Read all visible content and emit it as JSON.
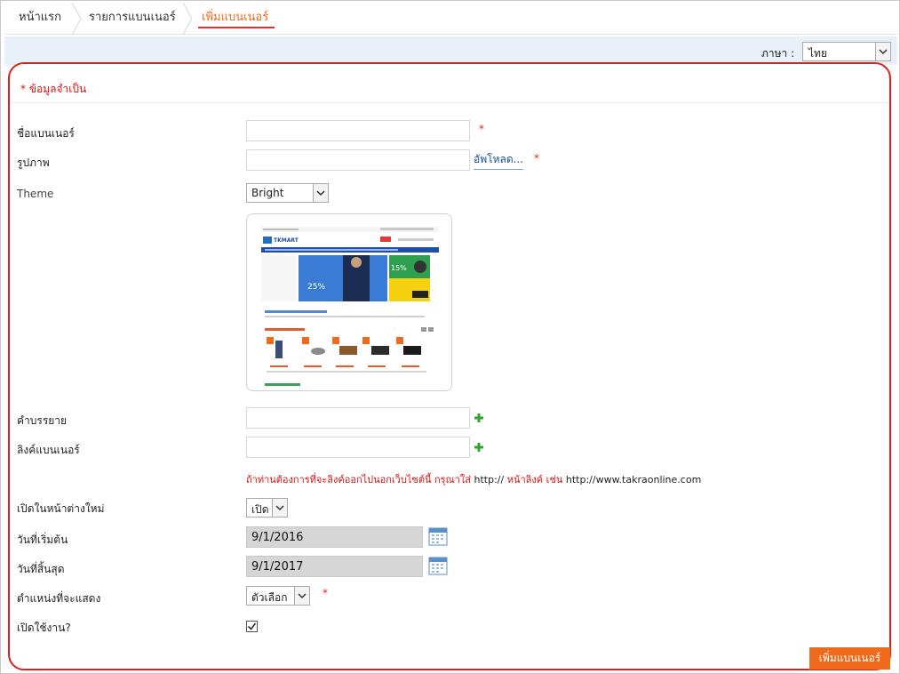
{
  "breadcrumb": {
    "home": "หน้าแรก",
    "list": "รายการแบนเนอร์",
    "current": "เพิ่มแบนเนอร์"
  },
  "language": {
    "label": "ภาษา :",
    "value": "ไทย"
  },
  "form": {
    "required_note": "* ข้อมูลจำเป็น",
    "banner_name_label": "ชื่อแบนเนอร์",
    "image_label": "รูปภาพ",
    "upload_label": "อัพโหลด...",
    "theme_label": "Theme",
    "theme_value": "Bright",
    "description_label": "คำบรรยาย",
    "link_label": "ลิงค์แบนเนอร์",
    "hint_a": "ถ้าท่านต้องการที่จะลิงค์ออกไปนอกเว็บไซต์นี้ กรุณาใส่ ",
    "hint_b": "http://",
    "hint_c": " หน้าลิงค์ เช่น ",
    "hint_d": "http://www.takraonline.com",
    "new_window_label": "เปิดในหน้าต่างใหม่",
    "new_window_value": "เปิด",
    "start_date_label": "วันที่เริ่มต้น",
    "start_date_value": "9/1/2016",
    "end_date_label": "วันที่สิ้นสุด",
    "end_date_value": "9/1/2017",
    "position_label": "ตำแหน่งที่จะแสดง",
    "position_value": "ตัวเลือก",
    "active_label": "เปิดใช้งาน?",
    "active_checked": true,
    "required_star": "*",
    "submit_label": "เพิ่มแบนเนอร์"
  },
  "preview": {
    "brand": "TKMART",
    "promo_a": "25%",
    "promo_b": "15%"
  },
  "colors": {
    "accent": "#f06a1c",
    "required": "#dd1111",
    "panel_border": "#e01e1e",
    "plus": "#2fa52f"
  }
}
